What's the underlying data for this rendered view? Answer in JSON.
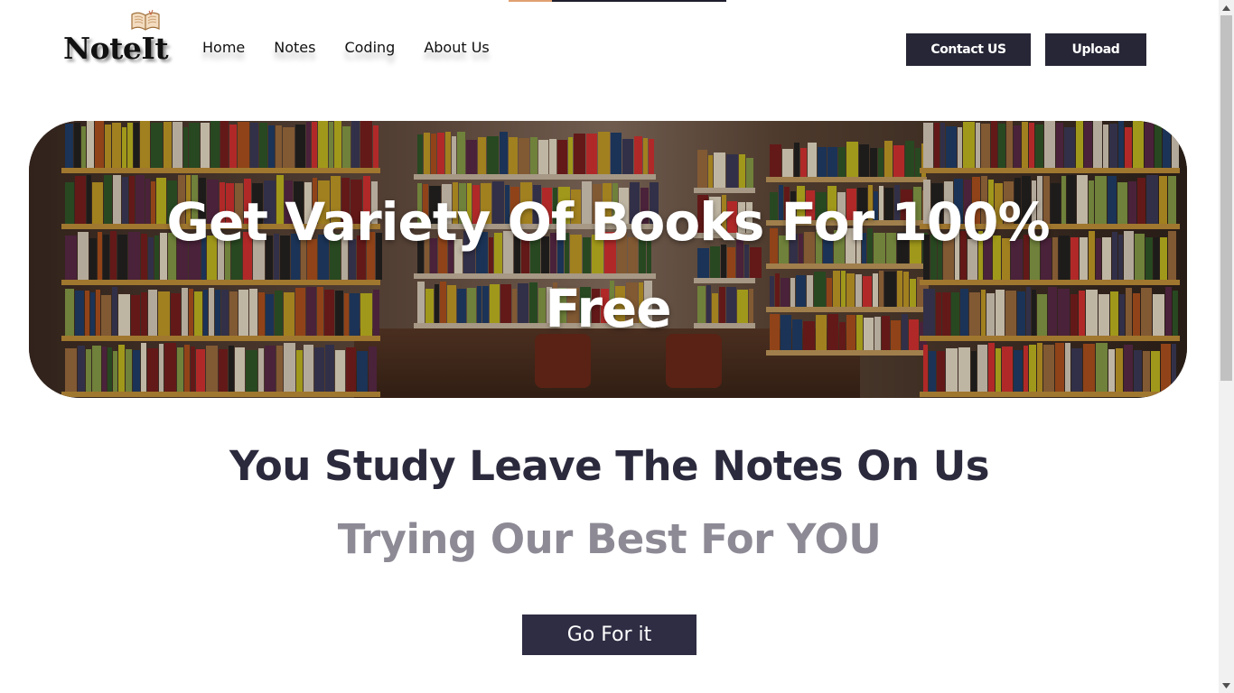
{
  "header": {
    "logo_text": "NoteIt",
    "logo_icon": "open-book-icon",
    "nav": [
      {
        "label": "Home"
      },
      {
        "label": "Notes"
      },
      {
        "label": "Coding"
      },
      {
        "label": "About Us"
      }
    ],
    "contact_label": "Contact US",
    "upload_label": "Upload"
  },
  "hero": {
    "line1": "Get Variety Of Books For 100%",
    "line2": "Free",
    "background": "library-bookshelves-photo"
  },
  "main": {
    "heading": "You Study Leave The Notes On Us",
    "subheading": "Trying Our Best For YOU",
    "cta_label": "Go For it"
  },
  "colors": {
    "dark_button": "#262636",
    "heading": "#2b2a3d",
    "subheading": "#8d8a95",
    "progress_accent": "#e0a070"
  },
  "page_progress": 0.2
}
